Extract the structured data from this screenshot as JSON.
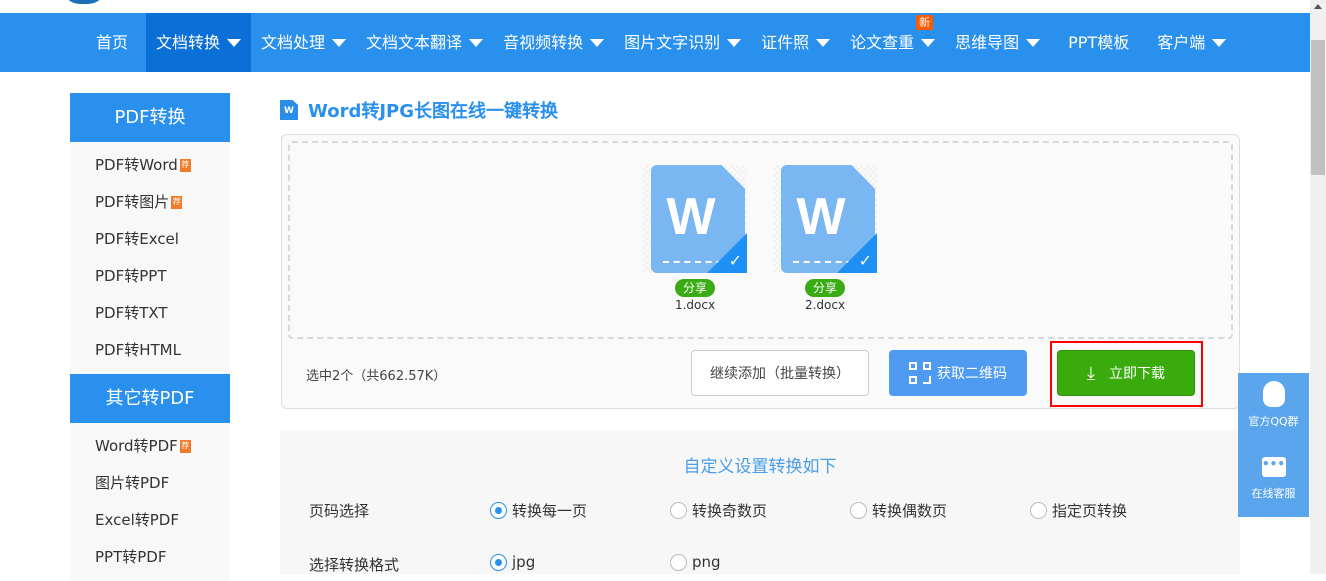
{
  "nav": {
    "items": [
      {
        "label": "首页",
        "dropdown": false
      },
      {
        "label": "文档转换",
        "dropdown": true,
        "active": true
      },
      {
        "label": "文档处理",
        "dropdown": true
      },
      {
        "label": "文档文本翻译",
        "dropdown": true
      },
      {
        "label": "音视频转换",
        "dropdown": true
      },
      {
        "label": "图片文字识别",
        "dropdown": true
      },
      {
        "label": "证件照",
        "dropdown": true
      },
      {
        "label": "论文查重",
        "dropdown": true,
        "badge": "新"
      },
      {
        "label": "思维导图",
        "dropdown": true
      },
      {
        "label": "PPT模板",
        "dropdown": false
      },
      {
        "label": "客户端",
        "dropdown": true
      }
    ]
  },
  "sidebar": {
    "sections": [
      {
        "title": "PDF转换",
        "items": [
          {
            "label": "PDF转Word",
            "badge": "荐"
          },
          {
            "label": "PDF转图片",
            "badge": "荐"
          },
          {
            "label": "PDF转Excel"
          },
          {
            "label": "PDF转PPT"
          },
          {
            "label": "PDF转TXT"
          },
          {
            "label": "PDF转HTML"
          }
        ]
      },
      {
        "title": "其它转PDF",
        "items": [
          {
            "label": "Word转PDF",
            "badge": "荐"
          },
          {
            "label": "图片转PDF"
          },
          {
            "label": "Excel转PDF"
          },
          {
            "label": "PPT转PDF"
          }
        ]
      }
    ]
  },
  "page": {
    "title": "Word转JPG长图在线一键转换",
    "title_icon_letter": "W"
  },
  "upload": {
    "files": [
      {
        "name": "1.docx",
        "share": "分享",
        "letter": "W"
      },
      {
        "name": "2.docx",
        "share": "分享",
        "letter": "W"
      }
    ],
    "selection_info": "选中2个（共662.57K）",
    "add_more": "继续添加（批量转换）",
    "qr": "获取二维码",
    "download": "立即下载"
  },
  "settings": {
    "title": "自定义设置转换如下",
    "page_select": {
      "label": "页码选择",
      "options": [
        "转换每一页",
        "转换奇数页",
        "转换偶数页",
        "指定页转换"
      ],
      "selected": 0
    },
    "format": {
      "label": "选择转换格式",
      "options": [
        "jpg",
        "png"
      ],
      "selected": 0
    }
  },
  "float": {
    "qq": "官方QQ群",
    "service": "在线客服"
  },
  "colors": {
    "primary": "#2a90ee",
    "nav_active": "#0a6fd6",
    "download": "#3aab0c",
    "highlight": "#ff0000"
  }
}
